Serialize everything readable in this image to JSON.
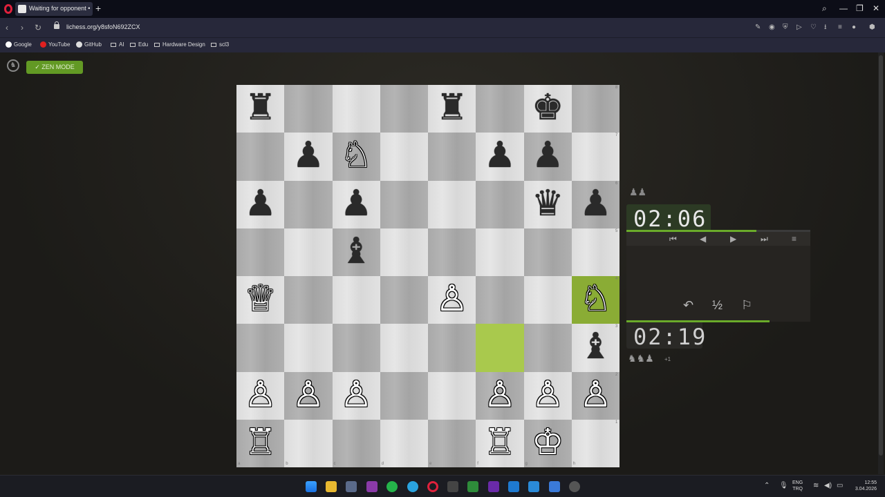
{
  "browser": {
    "tab_title": "Waiting for opponent • Pl",
    "new_tab": "+",
    "url": "lichess.org/y8sfoN692ZCX",
    "window_controls": {
      "search": "⌕",
      "minimize": "—",
      "restore": "❐",
      "close": "✕"
    },
    "nav": {
      "back": "‹",
      "forward": "›",
      "reload": "↻"
    },
    "bookmarks": [
      "Google",
      "YouTube",
      "GitHub",
      "AI",
      "Edu",
      "Hardware Design",
      "scl3"
    ]
  },
  "page": {
    "zen_mode_label": "ZEN MODE",
    "opponent_clock": "02:06",
    "player_clock": "02:19",
    "opponent_material_icons": "♟♟",
    "player_material_icons": "♞♞♟",
    "player_material_plus": "+1",
    "moves_nav": {
      "first": "⏮",
      "prev": "◀",
      "next": "▶",
      "last": "⏭",
      "menu": "≡"
    },
    "controls": {
      "takeback": "↶",
      "draw": "½",
      "resign": "⚐"
    }
  },
  "board": {
    "orientation": "white",
    "pieces": [
      {
        "sq": "a8",
        "piece": "♜",
        "color": "b"
      },
      {
        "sq": "e8",
        "piece": "♜",
        "color": "b"
      },
      {
        "sq": "g8",
        "piece": "♚",
        "color": "b"
      },
      {
        "sq": "b7",
        "piece": "♟",
        "color": "b"
      },
      {
        "sq": "c7",
        "piece": "♘",
        "color": "w"
      },
      {
        "sq": "f7",
        "piece": "♟",
        "color": "b"
      },
      {
        "sq": "g7",
        "piece": "♟",
        "color": "b"
      },
      {
        "sq": "a6",
        "piece": "♟",
        "color": "b"
      },
      {
        "sq": "c6",
        "piece": "♟",
        "color": "b"
      },
      {
        "sq": "g6",
        "piece": "♛",
        "color": "b"
      },
      {
        "sq": "h6",
        "piece": "♟",
        "color": "b"
      },
      {
        "sq": "c5",
        "piece": "♝",
        "color": "b"
      },
      {
        "sq": "a4",
        "piece": "♕",
        "color": "w"
      },
      {
        "sq": "e4",
        "piece": "♙",
        "color": "w"
      },
      {
        "sq": "h4",
        "piece": "♘",
        "color": "w"
      },
      {
        "sq": "h3",
        "piece": "♝",
        "color": "b"
      },
      {
        "sq": "a2",
        "piece": "♙",
        "color": "w"
      },
      {
        "sq": "b2",
        "piece": "♙",
        "color": "w"
      },
      {
        "sq": "c2",
        "piece": "♙",
        "color": "w"
      },
      {
        "sq": "f2",
        "piece": "♙",
        "color": "w"
      },
      {
        "sq": "g2",
        "piece": "♙",
        "color": "w"
      },
      {
        "sq": "h2",
        "piece": "♙",
        "color": "w"
      },
      {
        "sq": "a1",
        "piece": "♖",
        "color": "w"
      },
      {
        "sq": "f1",
        "piece": "♖",
        "color": "w"
      },
      {
        "sq": "g1",
        "piece": "♔",
        "color": "w"
      }
    ],
    "last_move": [
      "f3",
      "h4"
    ],
    "files": [
      "a",
      "b",
      "c",
      "d",
      "e",
      "f",
      "g",
      "h"
    ],
    "ranks": [
      "8",
      "7",
      "6",
      "5",
      "4",
      "3",
      "2",
      "1"
    ]
  },
  "taskbar": {
    "lang_top": "ENG",
    "lang_bottom": "TRQ",
    "time": "12:55",
    "date": "3.04.2026",
    "tray_up": "⌃"
  },
  "colors": {
    "accent": "#629924",
    "highlight": "#a9c94d"
  }
}
